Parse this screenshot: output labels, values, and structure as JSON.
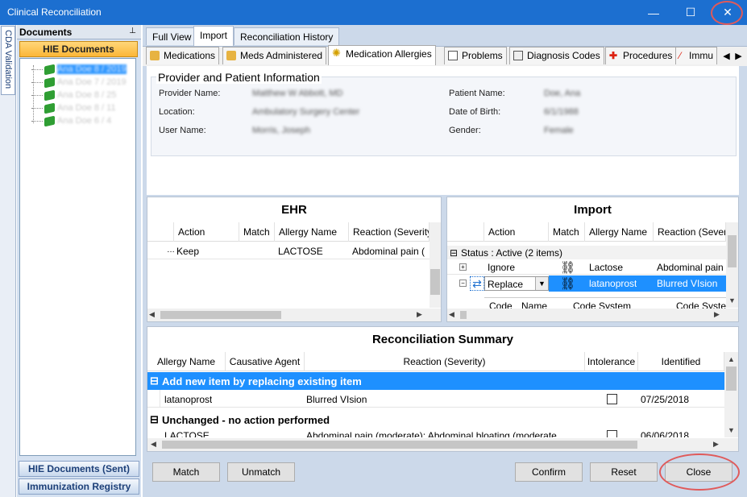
{
  "window": {
    "title": "Clinical Reconciliation",
    "minimize_glyph": "—",
    "maximize_glyph": "☐",
    "close_glyph": "✕"
  },
  "left": {
    "vertical_tab": "CDA Validation",
    "documents_header": "Documents",
    "pin_glyph": "⊥",
    "hie_documents": "HIE Documents",
    "tree_items": [
      "Ana Doe 8 / 2019",
      "Ana Doe 7 / 2019",
      "Ana Doe 8 / 25",
      "Ana Doe 8 / 11",
      "Ana Doe 6 / 4"
    ],
    "hie_sent": "HIE Documents (Sent)",
    "immunization_registry": "Immunization Registry"
  },
  "top_tabs": [
    "Full View",
    "Import",
    "Reconciliation History"
  ],
  "sub_tabs": [
    {
      "label": "Medications",
      "icon": "pill-bottle-icon"
    },
    {
      "label": "Meds Administered",
      "icon": "pill-bottle-icon"
    },
    {
      "label": "Medication Allergies",
      "icon": "allergy-icon"
    },
    {
      "label": "Problems",
      "icon": "chart-icon"
    },
    {
      "label": "Diagnosis Codes",
      "icon": "diagnosis-icon"
    },
    {
      "label": "Procedures",
      "icon": "red-cross-icon"
    },
    {
      "label": "Immu",
      "icon": "syringe-icon"
    }
  ],
  "tab_scroll": {
    "left": "◀",
    "right": "▶"
  },
  "provider_info": {
    "title": "Provider and Patient Information",
    "provider_name_label": "Provider Name:",
    "provider_name": "Matthew W Abbott, MD",
    "location_label": "Location:",
    "location": "Ambulatory Surgery Center",
    "user_name_label": "User Name:",
    "user_name": "Morris, Joseph",
    "patient_name_label": "Patient Name:",
    "patient_name": "Doe, Ana",
    "dob_label": "Date of Birth:",
    "dob": "6/1/1988",
    "gender_label": "Gender:",
    "gender": "Female"
  },
  "ehr": {
    "title": "EHR",
    "columns": [
      "Action",
      "Match",
      "Allergy Name",
      "Reaction (Severity"
    ],
    "rows": [
      {
        "action": "Keep",
        "match": "",
        "allergy": "LACTOSE",
        "reaction": "Abdominal pain ("
      }
    ]
  },
  "import": {
    "title": "Import",
    "columns": [
      "Action",
      "Match",
      "Allergy Name",
      "Reaction (Severi"
    ],
    "group": "Status : Active (2 items)",
    "rows": [
      {
        "expand": "+",
        "action": "Ignore",
        "allergy": "Lactose",
        "reaction": "Abdominal pain ("
      },
      {
        "expand": "−",
        "action": "Replace",
        "allergy": "latanoprost",
        "reaction": "Blurred VIsion"
      }
    ],
    "sub_columns": [
      "Code",
      "Name",
      "Code System",
      "Code Syster"
    ]
  },
  "summary": {
    "title": "Reconciliation Summary",
    "columns": [
      "Allergy Name",
      "Causative Agent",
      "Reaction (Severity)",
      "Intolerance",
      "Identified"
    ],
    "group1": "Add new item by replacing existing item",
    "row1": {
      "allergy": "latanoprost",
      "agent": "",
      "reaction": "Blurred VIsion",
      "identified": "07/25/2018"
    },
    "group2": "Unchanged - no action performed",
    "row2": {
      "allergy": "LACTOSE",
      "agent": "",
      "reaction": "Abdominal pain (moderate); Abdominal bloating (moderate",
      "identified": "06/06/2018"
    },
    "collapse_glyph": "⊟"
  },
  "buttons": {
    "match": "Match",
    "unmatch": "Unmatch",
    "confirm": "Confirm",
    "reset": "Reset",
    "close": "Close"
  },
  "scroll": {
    "up": "▲",
    "down": "▼",
    "left": "◀",
    "right": "▶"
  },
  "colors": {
    "title_bar": "#1c6fd0",
    "selection": "#1e90ff",
    "highlight_circle": "#e05a5a",
    "hie_button": "#fbb637"
  }
}
